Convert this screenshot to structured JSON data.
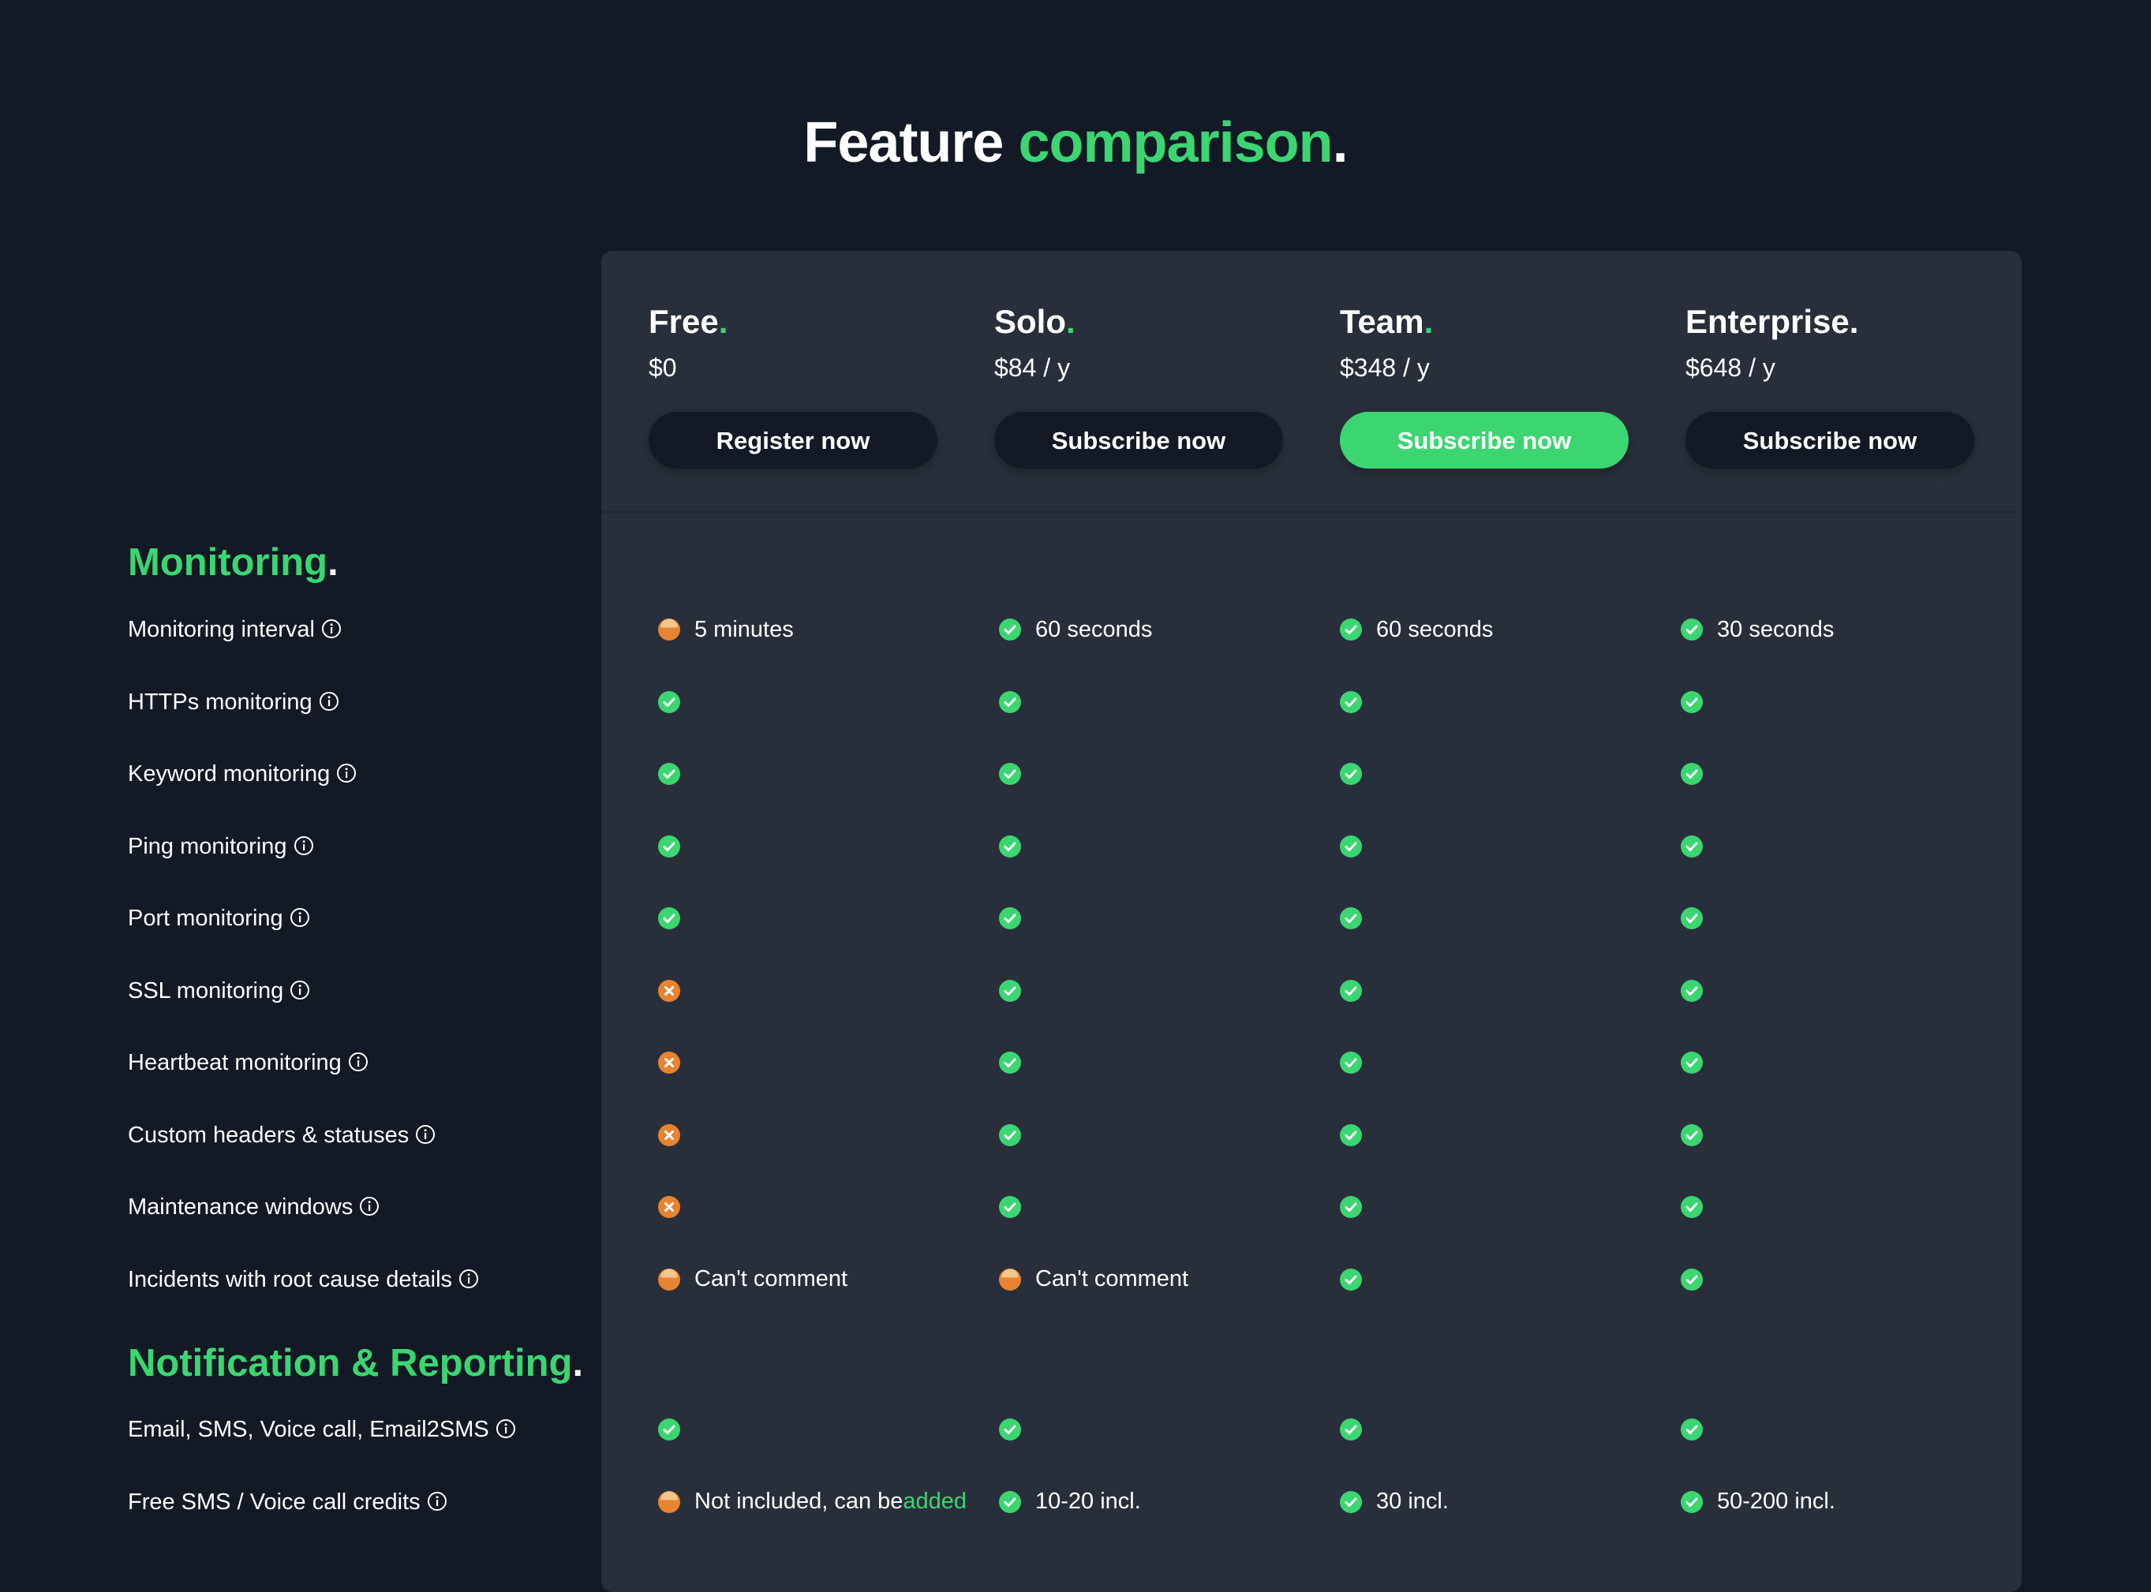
{
  "page": {
    "title_part1": "Feature",
    "title_part2": "comparison",
    "title_dot": "."
  },
  "colors": {
    "accent": "#3bd671",
    "warning": "#e8832f",
    "background": "#131925",
    "panel": "#282f3a"
  },
  "plans": [
    {
      "name": "Free",
      "price": "$0",
      "button": "Register now",
      "primary": false
    },
    {
      "name": "Solo",
      "price": "$84 / y",
      "button": "Subscribe now",
      "primary": false
    },
    {
      "name": "Team",
      "price": "$348 / y",
      "button": "Subscribe now",
      "primary": true
    },
    {
      "name": "Enterprise.",
      "price": "$648 / y",
      "button": "Subscribe now",
      "primary": false
    }
  ],
  "sections": [
    {
      "title": "Monitoring",
      "rows": [
        {
          "label": "Monitoring interval",
          "cells": [
            {
              "status": "partial",
              "text": "5 minutes"
            },
            {
              "status": "yes",
              "text": "60 seconds"
            },
            {
              "status": "yes",
              "text": "60 seconds"
            },
            {
              "status": "yes",
              "text": "30 seconds"
            }
          ]
        },
        {
          "label": "HTTPs monitoring",
          "cells": [
            {
              "status": "yes",
              "text": ""
            },
            {
              "status": "yes",
              "text": ""
            },
            {
              "status": "yes",
              "text": ""
            },
            {
              "status": "yes",
              "text": ""
            }
          ]
        },
        {
          "label": "Keyword monitoring",
          "cells": [
            {
              "status": "yes",
              "text": ""
            },
            {
              "status": "yes",
              "text": ""
            },
            {
              "status": "yes",
              "text": ""
            },
            {
              "status": "yes",
              "text": ""
            }
          ]
        },
        {
          "label": "Ping monitoring",
          "cells": [
            {
              "status": "yes",
              "text": ""
            },
            {
              "status": "yes",
              "text": ""
            },
            {
              "status": "yes",
              "text": ""
            },
            {
              "status": "yes",
              "text": ""
            }
          ]
        },
        {
          "label": "Port monitoring",
          "cells": [
            {
              "status": "yes",
              "text": ""
            },
            {
              "status": "yes",
              "text": ""
            },
            {
              "status": "yes",
              "text": ""
            },
            {
              "status": "yes",
              "text": ""
            }
          ]
        },
        {
          "label": "SSL monitoring",
          "cells": [
            {
              "status": "no",
              "text": ""
            },
            {
              "status": "yes",
              "text": ""
            },
            {
              "status": "yes",
              "text": ""
            },
            {
              "status": "yes",
              "text": ""
            }
          ]
        },
        {
          "label": "Heartbeat monitoring",
          "cells": [
            {
              "status": "no",
              "text": ""
            },
            {
              "status": "yes",
              "text": ""
            },
            {
              "status": "yes",
              "text": ""
            },
            {
              "status": "yes",
              "text": ""
            }
          ]
        },
        {
          "label": "Custom headers & statuses",
          "cells": [
            {
              "status": "no",
              "text": ""
            },
            {
              "status": "yes",
              "text": ""
            },
            {
              "status": "yes",
              "text": ""
            },
            {
              "status": "yes",
              "text": ""
            }
          ]
        },
        {
          "label": "Maintenance windows",
          "cells": [
            {
              "status": "no",
              "text": ""
            },
            {
              "status": "yes",
              "text": ""
            },
            {
              "status": "yes",
              "text": ""
            },
            {
              "status": "yes",
              "text": ""
            }
          ]
        },
        {
          "label": "Incidents with root cause details",
          "cells": [
            {
              "status": "partial",
              "text": "Can't comment"
            },
            {
              "status": "partial",
              "text": "Can't comment"
            },
            {
              "status": "yes",
              "text": ""
            },
            {
              "status": "yes",
              "text": ""
            }
          ]
        }
      ]
    },
    {
      "title": "Notification & Reporting",
      "rows": [
        {
          "label": "Email, SMS, Voice call, Email2SMS",
          "cells": [
            {
              "status": "yes",
              "text": ""
            },
            {
              "status": "yes",
              "text": ""
            },
            {
              "status": "yes",
              "text": ""
            },
            {
              "status": "yes",
              "text": ""
            }
          ]
        },
        {
          "label": "Free SMS / Voice call credits",
          "cells": [
            {
              "status": "partial",
              "text": "Not included, can be ",
              "link": "added"
            },
            {
              "status": "yes",
              "text": "10-20 incl."
            },
            {
              "status": "yes",
              "text": "30 incl."
            },
            {
              "status": "yes",
              "text": "50-200 incl."
            }
          ]
        }
      ]
    }
  ]
}
